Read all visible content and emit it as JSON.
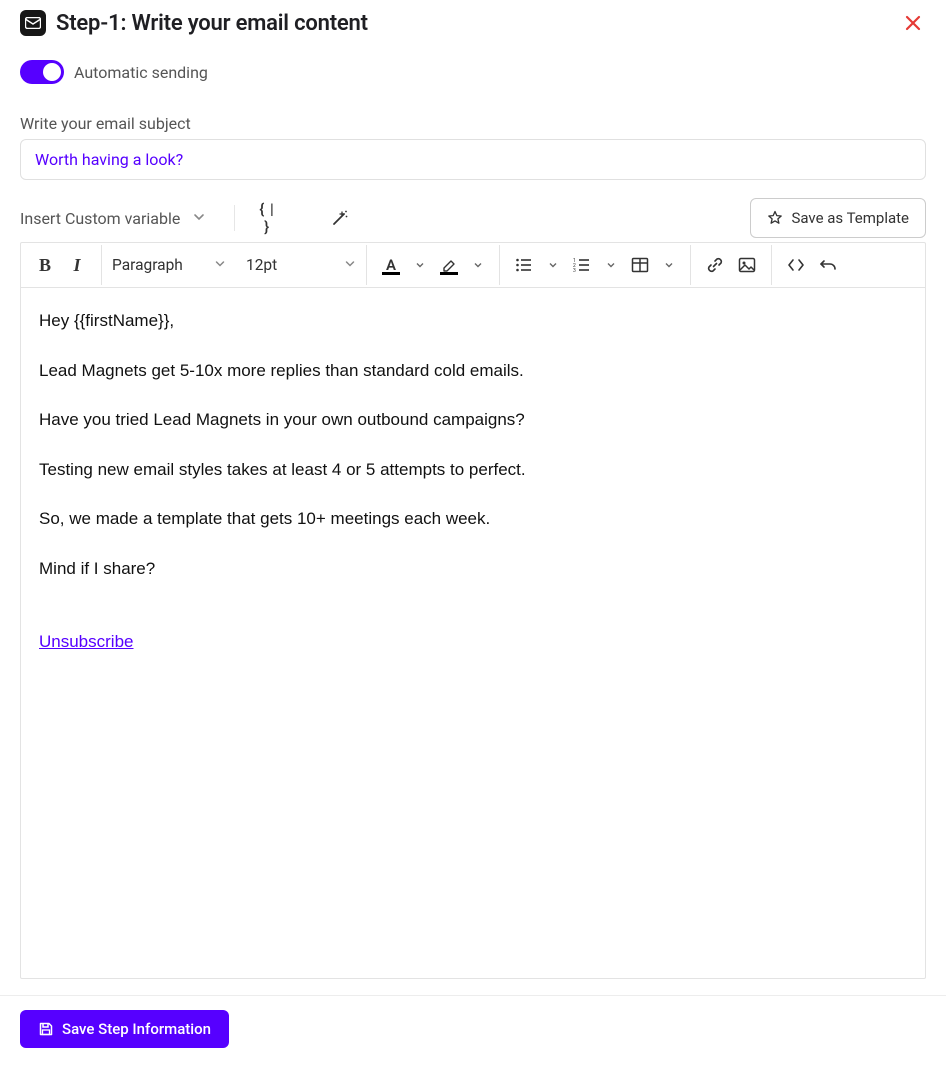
{
  "header": {
    "title": "Step-1:  Write your email content"
  },
  "automatic_sending": {
    "label": "Automatic sending",
    "enabled": true
  },
  "subject": {
    "label": "Write your email subject",
    "value": "Worth having a look?"
  },
  "custom_variable": {
    "label": "Insert Custom variable"
  },
  "save_template_label": "Save as Template",
  "toolbar": {
    "paragraph_label": "Paragraph",
    "font_size_label": "12pt"
  },
  "email_body": {
    "p1": "Hey {{firstName}},",
    "p2": "Lead Magnets get 5-10x more replies than standard cold emails.",
    "p3": "Have you tried Lead Magnets in your own outbound campaigns?",
    "p4": "Testing new email styles takes at least 4 or 5 attempts to perfect.",
    "p5": "So, we made a template that gets 10+ meetings each week.",
    "p6": "Mind if I share?",
    "unsubscribe": "Unsubscribe"
  },
  "footer": {
    "save_step_label": "Save Step Information"
  },
  "colors": {
    "accent": "#5600ff",
    "danger": "#e53935"
  }
}
